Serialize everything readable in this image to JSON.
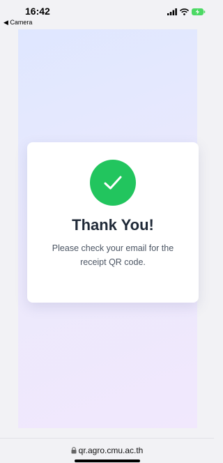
{
  "status_bar": {
    "time": "16:42",
    "back_label": "◀ Camera",
    "icons": [
      "signal-icon",
      "wifi-icon",
      "battery-charging-icon"
    ]
  },
  "card": {
    "icon": "checkmark-icon",
    "title": "Thank You!",
    "message": "Please check your email for the receipt QR code."
  },
  "browser": {
    "url": "qr.agro.cmu.ac.th"
  },
  "colors": {
    "success": "#22c55e",
    "title": "#1f2937",
    "message": "#4b5563",
    "background_start": "#dfe7ff",
    "background_end": "#f1e8fd"
  }
}
